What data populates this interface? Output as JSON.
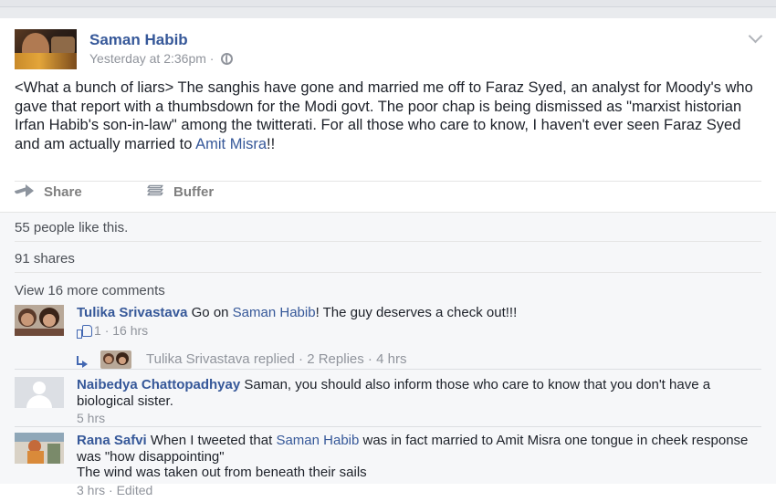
{
  "post": {
    "author": "Saman Habib",
    "timestamp": "Yesterday at 2:36pm",
    "separator": "·",
    "text_before_link": "<What a bunch of liars> The sanghis have gone and married me off to Faraz Syed, an analyst for Moody's who gave that report with a thumbsdown for the Modi govt. The poor chap is being dismissed as \"marxist historian Irfan Habib's son-in-law\" among the twitterati. For all those who care to know, I haven't ever seen Faraz Syed and am actually married to ",
    "link_text": "Amit Misra",
    "text_after_link": "!!",
    "share_label": "Share",
    "buffer_label": "Buffer",
    "likes_text": "55 people like this.",
    "shares_text": "91 shares"
  },
  "comments_section": {
    "view_more": "View 16 more comments",
    "comments": [
      {
        "author": "Tulika Srivastava",
        "text_before": " Go on ",
        "mention": "Saman Habib",
        "text_after": "! The guy deserves a check out!!!",
        "like_count": "1",
        "meta_sep": "·",
        "time": "16 hrs"
      },
      {
        "author": "Naibedya Chattopadhyay",
        "text": " Saman, you should also inform those who care to know that you don't have a biological sister.",
        "time": "5 hrs"
      },
      {
        "author": "Rana Safvi",
        "text_before": " When I tweeted that ",
        "mention": "Saman Habib",
        "text_after": " was in fact married to Amit Misra one tongue in cheek response was \"how disappointing\"",
        "text_line2": "The wind was taken out from beneath their sails",
        "time": "3 hrs",
        "meta_sep": "·",
        "edited": "Edited"
      }
    ],
    "reply": {
      "author": "Tulika Srivastava",
      "action": "replied",
      "sep": "·",
      "count": "2 Replies",
      "sep2": "·",
      "time": "4 hrs"
    }
  },
  "colors": {
    "link": "#365899",
    "meta": "#90949c",
    "background": "#e9ebee"
  }
}
